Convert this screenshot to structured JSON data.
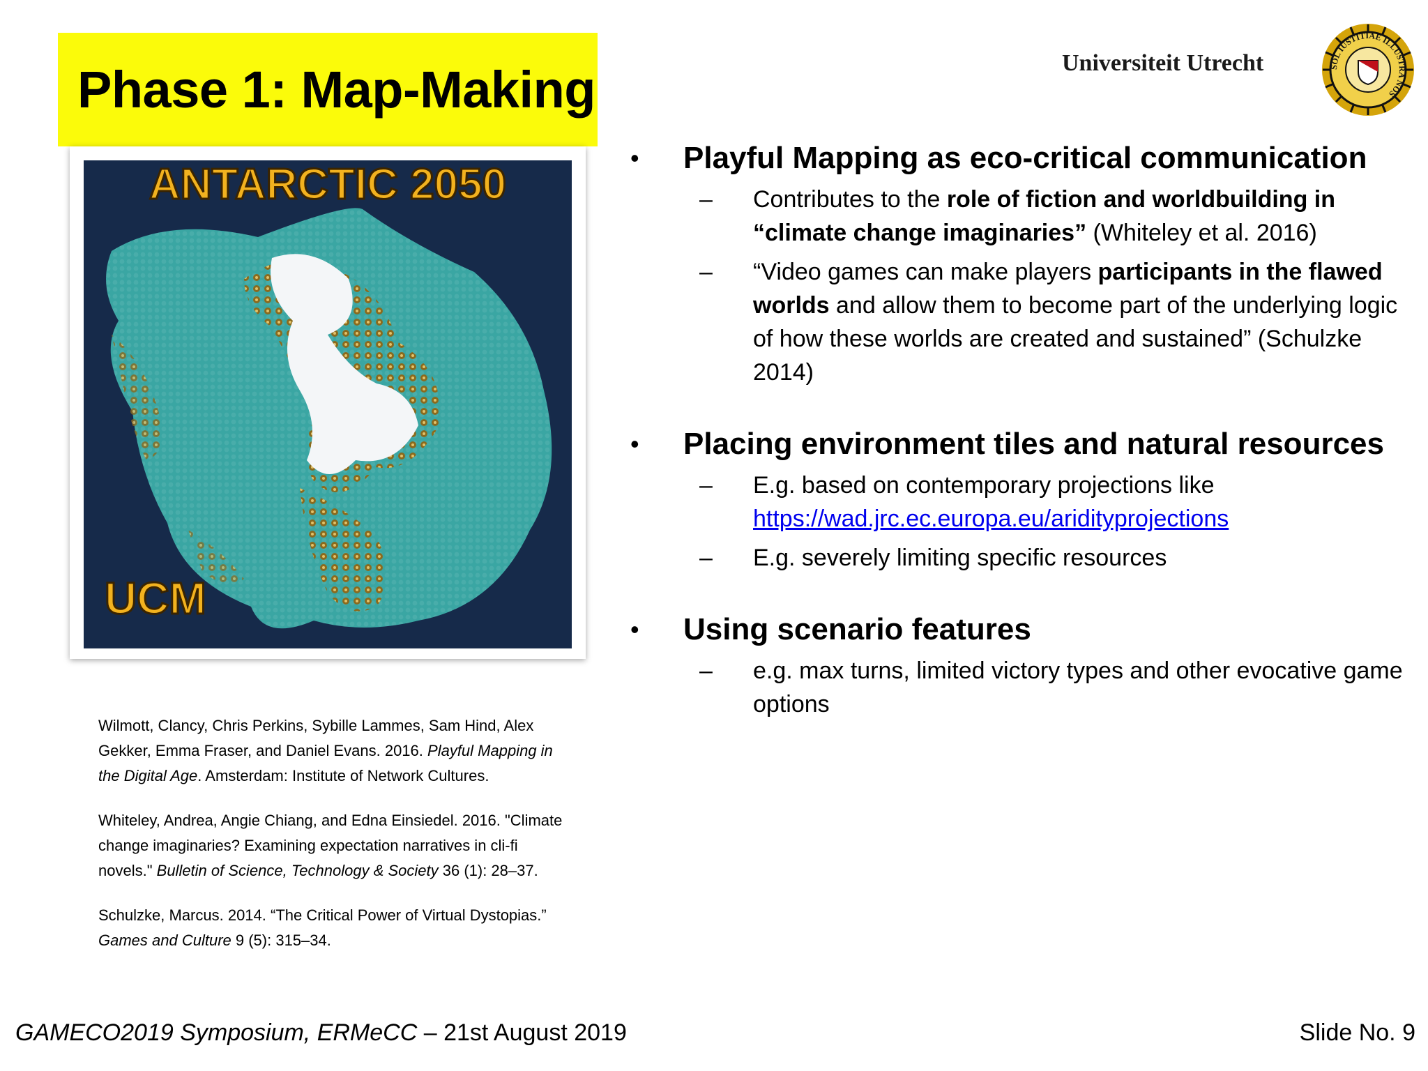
{
  "title": "Phase 1: Map-Making",
  "logo": {
    "name": "Universiteit Utrecht",
    "seal_text": "SOL IUSTITIAE ILLUSTRA NOS"
  },
  "map_image": {
    "title": "ANTARCTIC 2050",
    "caption": "UCM"
  },
  "references": [
    {
      "pre": "Wilmott, Clancy, Chris Perkins, Sybille Lammes, Sam Hind, Alex Gekker, Emma Fraser, and Daniel Evans. 2016. ",
      "ital": "Playful Mapping in the Digital Age",
      "post": ". Amsterdam: Institute of Network Cultures."
    },
    {
      "pre": "Whiteley, Andrea, Angie Chiang, and Edna Einsiedel. 2016. \"Climate change imaginaries? Examining expectation narratives in cli-fi novels.\" ",
      "ital": "Bulletin of Science, Technology & Society",
      "post": " 36 (1): 28–37."
    },
    {
      "pre": "Schulzke, Marcus. 2014. “The Critical Power of Virtual Dystopias.” ",
      "ital": "Games and Culture",
      "post": " 9 (5): 315–34."
    }
  ],
  "bullets": [
    {
      "heading": "Playful Mapping as eco-critical communication",
      "items": [
        {
          "a": "Contributes to the ",
          "b": "role of fiction and worldbuilding in “climate change imaginaries”",
          "c": " (Whiteley et al. 2016)"
        },
        {
          "a": "“Video games can make players ",
          "b": "participants in the flawed worlds",
          "c": " and allow them to become part of the underlying logic of how these worlds are created and sustained” (Schulzke 2014)"
        }
      ]
    },
    {
      "heading": "Placing environment tiles and natural resources",
      "items": [
        {
          "a": "E.g. based on contemporary projections like ",
          "link": "https://wad.jrc.ec.europa.eu/aridityprojections"
        },
        {
          "a": "E.g. severely limiting specific resources"
        }
      ]
    },
    {
      "heading": "Using scenario features",
      "items": [
        {
          "a": "e.g. max turns, limited victory types and other evocative game options"
        }
      ]
    }
  ],
  "footer": {
    "event": "GAMECO2019 Symposium, ERMeCC",
    "date": " – 21st August 2019",
    "slide": "Slide No. 9"
  },
  "colors": {
    "title_bg": "#fbfb0a",
    "ocean": "#162a4a",
    "land": "#3aa6a3",
    "ice": "#f4f6f8",
    "link": "#0000ee"
  }
}
